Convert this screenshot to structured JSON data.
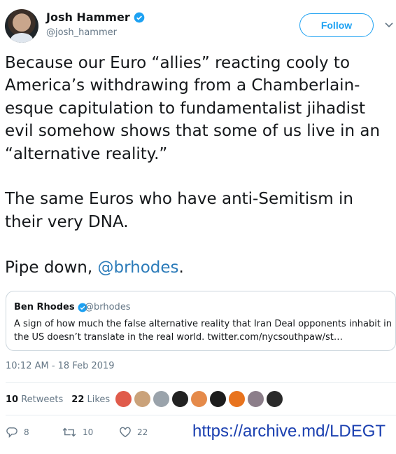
{
  "author": {
    "name": "Josh Hammer",
    "handle": "@josh_hammer"
  },
  "follow_label": "Follow",
  "tweet": {
    "text": "Because our Euro “allies” reacting cooly to America’s withdrawing from a Chamberlain-esque capitulation to fundamentalist jihadist evil somehow shows that some of us live in an “alternative reality.”\n\nThe same Euros who have anti-Semitism in their very DNA.\n\nPipe down, ",
    "mention": "@brhodes",
    "trail": "."
  },
  "quoted": {
    "name": "Ben Rhodes",
    "handle": "@brhodes",
    "text": "A sign of how much the false alternative reality that Iran Deal opponents inhabit in the US doesn’t translate in the real world. twitter.com/nycsouthpaw/st…"
  },
  "timestamp": "10:12 AM - 18 Feb 2019",
  "stats": {
    "retweets_count": "10",
    "retweets_label": "Retweets",
    "likes_count": "22",
    "likes_label": "Likes"
  },
  "actions": {
    "replies": "8",
    "retweets": "10",
    "likes": "22"
  },
  "archive_url": "https://archive.md/LDEGT",
  "colors": {
    "accent": "#1da1f2",
    "mention": "#2b7bb9",
    "muted": "#657786",
    "archive_link": "#1a3fb0"
  },
  "liker_colors": [
    "#e05b4b",
    "#caa27a",
    "#9aa3ab",
    "#222222",
    "#e58a4a",
    "#1d1d1d",
    "#e8731e",
    "#8c7e8a",
    "#2a2a2a"
  ]
}
